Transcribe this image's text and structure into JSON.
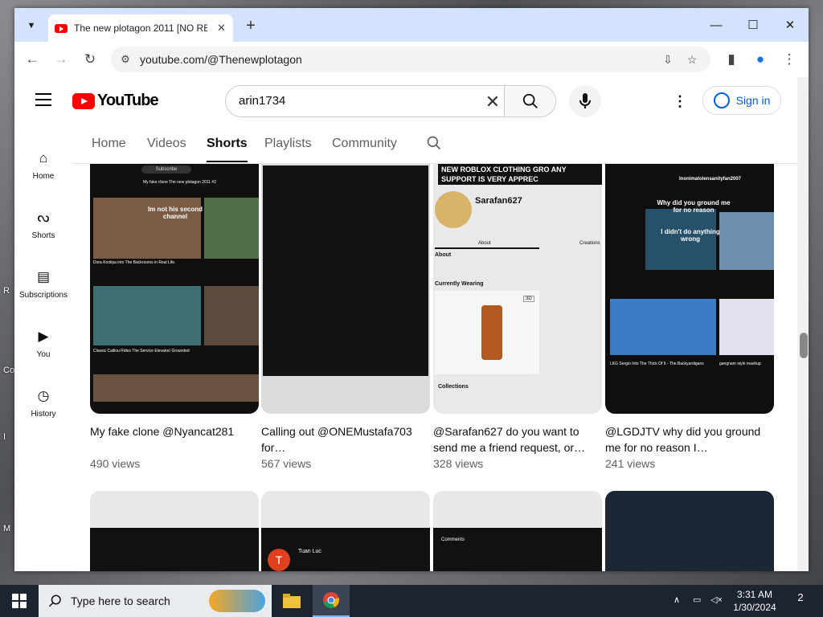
{
  "desktop": {
    "labels": [
      "R",
      "Co",
      "I",
      "M"
    ]
  },
  "browser": {
    "tab_title": "The new plotagon 2011 [NO RE",
    "url": "youtube.com/@Thenewplotagon",
    "colors": {
      "tabbar": "#d3e3fd",
      "omnibox": "#f1f3f4"
    }
  },
  "youtube": {
    "logo_text": "YouTube",
    "search_value": "arin1734",
    "signin_label": "Sign in",
    "guide": [
      {
        "label": "Home",
        "icon": "home-icon"
      },
      {
        "label": "Shorts",
        "icon": "shorts-icon"
      },
      {
        "label": "Subscriptions",
        "icon": "subscriptions-icon"
      },
      {
        "label": "You",
        "icon": "you-icon"
      },
      {
        "label": "History",
        "icon": "history-icon"
      }
    ],
    "tabs": [
      "Home",
      "Videos",
      "Shorts",
      "Playlists",
      "Community"
    ],
    "active_tab": "Shorts",
    "shorts": [
      {
        "title": "My fake clone @Nyancat281",
        "views": "490 views"
      },
      {
        "title": "Calling out @ONEMustafa703 for…",
        "views": "567 views"
      },
      {
        "title": "@Sarafan627 do you want to send me a friend request, or…",
        "views": "328 views"
      },
      {
        "title": "@LGDJTV why did you ground me for no reason I…",
        "views": "241 views"
      }
    ],
    "thumb_text": {
      "t1_subscribe": "Subscribe",
      "t1_channel": "My fake clone The new plotagon 2011 #2",
      "t1_overlay": "Im not his second channel",
      "t1_cap1": "Dora Koolipa into The Backrooms in Real Life.",
      "t1_cap2": "Classic Caillou Rides The Service Elevator/ Grounded",
      "t3_banner": "NEW ROBLOX CLOTHING GRO ANY SUPPORT IS VERY APPREC",
      "t3_user": "Sarafan627",
      "t3_tab_about": "About",
      "t3_tab_creations": "Creations",
      "t3_about": "About",
      "t3_wearing": "Currently Wearing",
      "t3_3d": "3D",
      "t3_collections": "Collections",
      "t4_channel": "Inonimatolensanityfan2007",
      "t4_overlay1": "Why did you ground me for no reason",
      "t4_overlay2": "I didn't do anything wrong",
      "t4_cap": "LKG Sergio Into The Thick Of It - The Backyardigans",
      "t4_cap2": "gangnam style mashup",
      "r2_name": "Tuan Luc",
      "r2_comments": "Comments"
    }
  },
  "taskbar": {
    "search_placeholder": "Type here to search",
    "time": "3:31 AM",
    "date": "1/30/2024",
    "notifications": "2"
  }
}
